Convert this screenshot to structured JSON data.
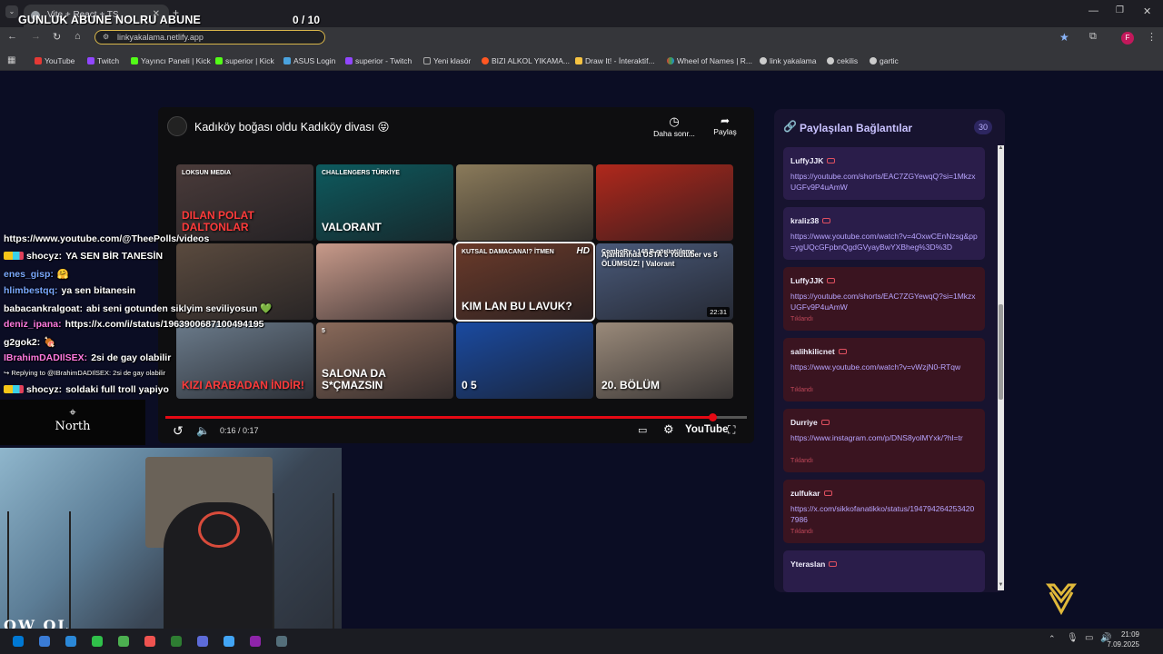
{
  "browser": {
    "tab_title": "Vite + React + TS",
    "url": "linkyakalama.netlify.app",
    "bookmarks": [
      "YouTube",
      "Twitch",
      "Yayıncı Paneli | Kick",
      "superior | Kick",
      "ASUS Login",
      "superior - Twitch",
      "Yeni klasör",
      "BIZI ALKOL YIKAMA...",
      "Draw It! - İnteraktif...",
      "Wheel of Names | R...",
      "link yakalama",
      "cekilis",
      "gartic"
    ],
    "profile_initial": "F"
  },
  "overlay": {
    "title": "GUNLUK ABUNE NOLRU ABUNE",
    "counter": "0  / 10"
  },
  "player": {
    "title": "Kadıköy boğası oldu Kadıköy divası 😝",
    "watch_later": "Daha sonr...",
    "share": "Paylaş",
    "time": "0:16 / 0:17",
    "progress": 0.94,
    "youtube_label": "YouTube",
    "thumbnails": [
      {
        "text": "DILAN POLAT DALTONLAR",
        "label": "LOKSUN MEDIA",
        "color": "#4a3b3a"
      },
      {
        "text": "VALORANT",
        "label": "CHALLENGERS TÜRKİYE",
        "color": "#0d5a5e"
      },
      {
        "text": "",
        "label": "",
        "color": "#8a7a5a"
      },
      {
        "text": "",
        "label": "",
        "color": "#b0281c"
      },
      {
        "text": "",
        "label": "",
        "color": "#5a4a3e"
      },
      {
        "text": "",
        "label": "",
        "color": "#c89a8a"
      },
      {
        "text": "KIM LAN BU LAVUK?",
        "label": "KUTSAL DAMACANA!? İTMEN",
        "color": "#6a3a2a",
        "badge": "HD"
      },
      {
        "text": "Ajanlarında USTA 5 Youtuber vs 5 ÖLÜMSÜZ! | Valorant",
        "label": "ComboRy • 148 B görüntüleme",
        "color": "#4a5a7a",
        "badge": "22:31"
      },
      {
        "text": "KIZI ARABADAN İNDİR!",
        "label": "",
        "color": "#6a7a8a"
      },
      {
        "text": "SALONA DA S*ÇMAZSIN",
        "label": "5",
        "color": "#8a6a5a"
      },
      {
        "text": "0 5",
        "label": "",
        "color": "#1a4aa0"
      },
      {
        "text": "20. BÖLÜM",
        "label": "",
        "color": "#9a8a7a"
      }
    ]
  },
  "chat": [
    {
      "user": "",
      "message": "https://www.youtube.com/@TheePolls/videos",
      "color": "#ffffff"
    },
    {
      "user": "shocyz:",
      "message": "YA SEN BİR TANESİN",
      "color": "#ffffff",
      "badges": true
    },
    {
      "user": "enes_gisp:",
      "message": "🤗",
      "color": "#7aa8ff"
    },
    {
      "user": "hlimbestqq:",
      "message": "ya sen bitanesin",
      "color": "#7aa8ff"
    },
    {
      "user": "babacankralgoat:",
      "message": "abi seni gotunden siklyim seviliyosun 💚",
      "color": "#ffffff"
    },
    {
      "user": "deniz_ipana:",
      "message": "https://x.com/i/status/1963900687100494195",
      "color": "#ff7ae0"
    },
    {
      "user": "g2gok2:",
      "message": "🍖",
      "color": "#ffffff"
    },
    {
      "user": "",
      "message": "↪ Replying to @IBrahimDADIlSEX: 2si de gay olabilir",
      "color": "#cccccc",
      "small": true
    },
    {
      "user": "IBrahimDADIlSEX:",
      "message": "2si de gay olabilir",
      "color": "#ff7ae0"
    },
    {
      "user": "shocyz:",
      "message": "soldaki full troll yapiyo",
      "color": "#ffffff",
      "badges": true
    }
  ],
  "north_label": "North",
  "webcam_label": "OW OL",
  "panel": {
    "title": "Paylaşılan Bağlantılar",
    "count": "30",
    "clicked_label": "Tıklandı",
    "links": [
      {
        "user": "LuffyJJK",
        "url": "https://youtube.com/shorts/EAC7ZGYewqQ?si=1MkzxUGFv9P4uAmW",
        "clicked": false
      },
      {
        "user": "kraliz38",
        "url": "https://www.youtube.com/watch?v=4OxwCEnNzsg&pp=ygUQcGFpbnQgdGVyayBwYXBheg%3D%3D",
        "clicked": false
      },
      {
        "user": "LuffyJJK",
        "url": "https://youtube.com/shorts/EAC7ZGYewqQ?si=1MkzxUGFv9P4uAmW",
        "clicked": true
      },
      {
        "user": "salihkilicnet",
        "url": "https://www.youtube.com/watch?v=vWzjN0-RTqw",
        "clicked": true
      },
      {
        "user": "Durriye",
        "url": "https://www.instagram.com/p/DNS8yolMYxk/?hl=tr",
        "clicked": true
      },
      {
        "user": "zulfukar",
        "url": "https://x.com/sikkofanatikko/status/1947942642534207986",
        "clicked": true
      },
      {
        "user": "Yteraslan",
        "url": "",
        "clicked": false
      }
    ]
  },
  "taskbar": {
    "time": "21:09",
    "date": "7.09.2025"
  },
  "colors": {
    "accent": "#8b7bff",
    "clicked": "#c0485a",
    "progress": "#e50914"
  }
}
